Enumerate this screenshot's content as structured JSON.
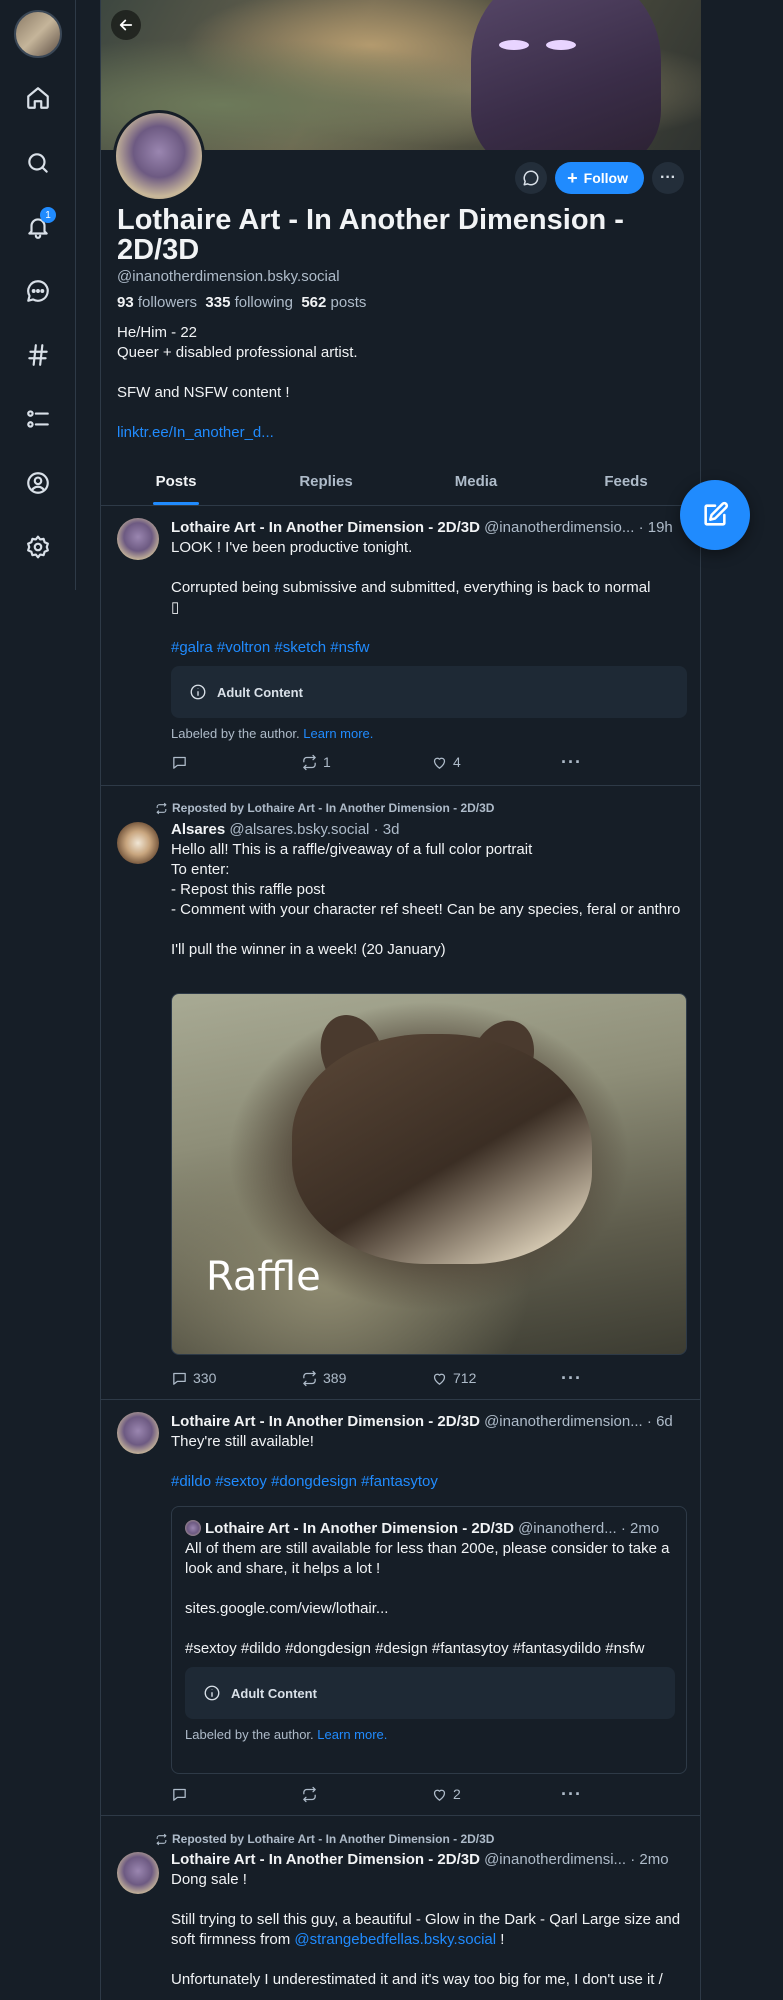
{
  "nav": {
    "items": [
      {
        "name": "home-icon"
      },
      {
        "name": "search-icon"
      },
      {
        "name": "notifications-icon",
        "badge": "1"
      },
      {
        "name": "chat-icon"
      },
      {
        "name": "feeds-hash-icon"
      },
      {
        "name": "lists-icon"
      },
      {
        "name": "profile-icon"
      },
      {
        "name": "settings-icon"
      }
    ]
  },
  "profile": {
    "display_name": "Lothaire Art - In Another Dimension - 2D/3D",
    "handle": "@inanotherdimension.bsky.social",
    "followers_count": "93",
    "followers_label": "followers",
    "following_count": "335",
    "following_label": "following",
    "posts_count": "562",
    "posts_label": "posts",
    "bio_line1": "He/Him - 22",
    "bio_line2": "Queer + disabled professional artist.",
    "bio_line3": "SFW and NSFW content !",
    "bio_link": "linktr.ee/In_another_d...",
    "follow_label": "Follow"
  },
  "tabs": [
    "Posts",
    "Replies",
    "Media",
    "Feeds"
  ],
  "posts": [
    {
      "author": "Lothaire Art - In Another Dimension - 2D/3D",
      "handle": "@inanotherdimensio...",
      "time": "· 19h",
      "text1": "LOOK ! I've been productive tonight.",
      "text2": "Corrupted being submissive and submitted, everything is back to normal",
      "text3": "▯",
      "tags": "#galra #voltron #sketch #nsfw",
      "adult_label": "Adult Content",
      "labeled_text": "Labeled by the author.",
      "learn_more": "Learn more.",
      "replies": "",
      "reposts": "1",
      "likes": "4"
    },
    {
      "repost_by": "Reposted by Lothaire Art - In Another Dimension - 2D/3D",
      "author": "Alsares",
      "handle": "@alsares.bsky.social",
      "time": "· 3d",
      "text1": "Hello all! This is a raffle/giveaway of a full color portrait",
      "text2": "To enter:",
      "text3": "- Repost this raffle post",
      "text4": "- Comment with your character ref sheet! Can be any species, feral or anthro",
      "text5": "I'll pull the winner in a week! (20 January)",
      "image_text": "Raffle",
      "replies": "330",
      "reposts": "389",
      "likes": "712"
    },
    {
      "author": "Lothaire Art - In Another Dimension - 2D/3D",
      "handle": "@inanotherdimension...",
      "time": "· 6d",
      "text1": "They're still available!",
      "tags": "#dildo #sextoy #dongdesign #fantasytoy",
      "quote": {
        "author": "Lothaire Art - In Another Dimension - 2D/3D",
        "handle": "@inanotherd...",
        "time": "· 2mo",
        "text1": "All of them are still available for less than 200e, please consider to take a look and share, it helps a lot !",
        "text2": "sites.google.com/view/lothair...",
        "text3": "#sextoy #dildo #dongdesign #design #fantasytoy #fantasydildo #nsfw",
        "adult_label": "Adult Content",
        "labeled_text": "Labeled by the author.",
        "learn_more": "Learn more."
      },
      "replies": "",
      "reposts": "",
      "likes": "2"
    },
    {
      "repost_by": "Reposted by Lothaire Art - In Another Dimension - 2D/3D",
      "author": "Lothaire Art - In Another Dimension - 2D/3D",
      "handle": "@inanotherdimensi...",
      "time": "· 2mo",
      "text1": "Dong sale !",
      "text2a": "Still trying to sell this guy, a beautiful - Glow in the Dark - Qarl Large size and soft firmness from ",
      "text2_mention": "@strangebedfellas.bsky.social",
      "text2b": " !",
      "text3": "Unfortunately I underestimated it and it's way too big for me, I don't use it /"
    }
  ]
}
